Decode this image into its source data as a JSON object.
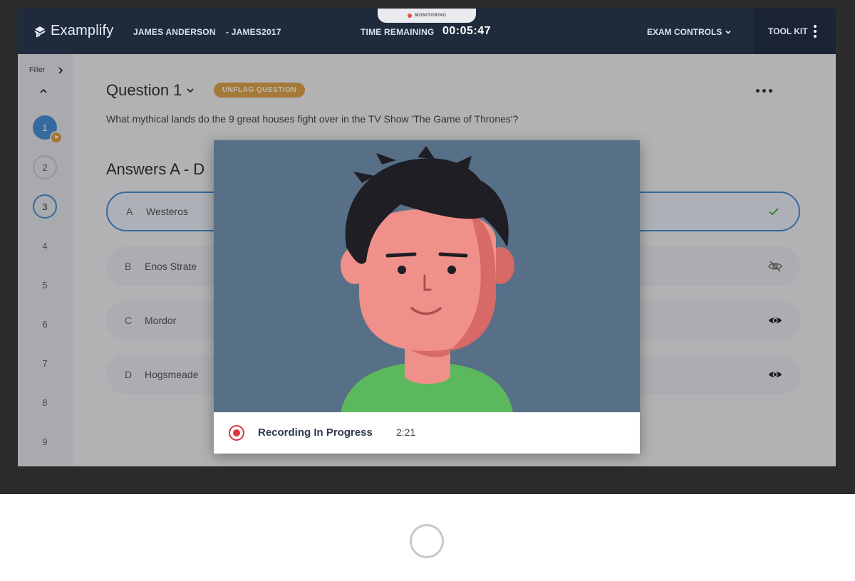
{
  "header": {
    "monitoring_label": "MONITORING",
    "app_name": "Examplify",
    "user_name": "JAMES ANDERSON",
    "user_id": "- JAMES2017",
    "time_label": "TIME REMAINING",
    "time_value": "00:05:47",
    "exam_controls": "EXAM CONTROLS",
    "tool_kit": "TOOL KIT"
  },
  "sidebar": {
    "filter_label": "Filter",
    "questions": [
      "1",
      "2",
      "3",
      "4",
      "5",
      "6",
      "7",
      "8",
      "9"
    ]
  },
  "question": {
    "title": "Question 1",
    "flag_button": "UNFLAG QUESTION",
    "text": "What mythical lands do the 9 great houses fight over in the TV Show 'The Game of Thrones'?",
    "answers_heading": "Answers A - D",
    "answers": [
      {
        "letter": "A",
        "text": "Westeros",
        "icon": "check-icon"
      },
      {
        "letter": "B",
        "text": "Enos Strate",
        "icon": "eye-slash-icon"
      },
      {
        "letter": "C",
        "text": "Mordor",
        "icon": "eye-icon"
      },
      {
        "letter": "D",
        "text": "Hogsmeade",
        "icon": "eye-icon"
      }
    ]
  },
  "recording": {
    "label": "Recording In Progress",
    "elapsed": "2:21"
  },
  "colors": {
    "header_bg": "#1f2b3d",
    "accent_blue": "#4a90d9",
    "flag_orange": "#e3a64c",
    "record_red": "#d9363e",
    "video_bg": "#587087",
    "shirt_green": "#5cb85c",
    "skin": "#f0908a"
  }
}
